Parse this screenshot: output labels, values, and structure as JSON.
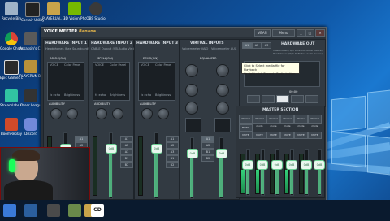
{
  "desktop_icons": [
    {
      "label": "Recycle Bin",
      "icon": "recycle-bin-icon",
      "color": "#9fb3c8"
    },
    {
      "label": "Corsair Utility Engine",
      "icon": "corsair-icon",
      "color": "#222222"
    },
    {
      "label": "PLAYERUN... BATTLEGR...",
      "icon": "pubg-icon",
      "color": "#c9a44a"
    },
    {
      "label": "3D Vision Photo Viewer",
      "icon": "nvidia-3d-icon",
      "color": "#76b900"
    },
    {
      "label": "OBS Studio",
      "icon": "obs-icon",
      "color": "#3a3a3a"
    },
    {
      "label": "Google Chrome",
      "icon": "chrome-icon",
      "color": "#e8c33a"
    },
    {
      "label": "Assassin's Creed Origins",
      "icon": "assassins-creed-icon",
      "color": "#5a5a5a"
    },
    {
      "label": "Epic Games Launcher",
      "icon": "epic-games-icon",
      "color": "#2a2a2a"
    },
    {
      "label": "PLAYERUN BATTLEGR...",
      "icon": "pubg-2-icon",
      "color": "#b8913a"
    },
    {
      "label": "Streamlabs OBS",
      "icon": "streamlabs-icon",
      "color": "#31c3a2"
    },
    {
      "label": "Laser Leagu",
      "icon": "laser-league-icon",
      "color": "#333333"
    },
    {
      "label": "BoomReplay",
      "icon": "boom-replay-icon",
      "color": "#d04a2a"
    },
    {
      "label": "Discord",
      "icon": "discord-icon",
      "color": "#7289da"
    }
  ],
  "vm": {
    "logo_prefix": "VOICE",
    "logo_middle": "MEETER",
    "logo_brand": "Banana",
    "hw_inputs": [
      {
        "title": "HARDWARE INPUT 1",
        "device": "Headphones (Rea Soundcard)",
        "label": "MIMIC(ON)"
      },
      {
        "title": "HARDWARE INPUT 2",
        "device": "CABLE Output (VB-Audio Virt)",
        "label": "SPELL(ON)"
      },
      {
        "title": "HARDWARE INPUT 3",
        "device": "",
        "label": "ECHO(ON)"
      }
    ],
    "intellipan": "Intellipan",
    "voice_label": "VOICE",
    "color_panel": "Color Panel",
    "fx_echo": "fx echo",
    "brightness": "Brightness",
    "audibility": "AUDIBILITY",
    "gate": "Gate",
    "virtual_inputs": "VIRTUAL INPUTS",
    "vi_names": [
      "Voicemeeter VAIO",
      "Voicemeeter AUX"
    ],
    "equalizer": "EQUALIZER",
    "hw_out": "HARDWARE OUT",
    "hw_out_devices": [
      "Headphones (High Definition Audio Device)",
      "Headphones (High Definition Audio Device)"
    ],
    "out_a_labels": [
      "A1",
      "A2",
      "A3"
    ],
    "vban": "VBAN",
    "menu": "Menu",
    "tooltip_line1": "Click to Select media file for Playback",
    "tooltip_line2": "Or right-click Record / Radio button",
    "rec_time": "00:00",
    "master_section": "MASTER SECTION",
    "master_labels": [
      "Normal mode",
      "Normal mode",
      "Normal mode",
      "Normal mode",
      "Normal mode",
      "Normal mode"
    ],
    "bus_labels": [
      "A1",
      "A2",
      "A3",
      "B1",
      "B2"
    ],
    "fader_db": [
      "0dB",
      "0dB",
      "0dB",
      "0dB",
      "0dB",
      "0dB",
      "0dB",
      "0dB",
      "0dB",
      "0dB",
      "0dB"
    ],
    "fader_gain": "Fader Gain",
    "mono": "MONO",
    "solo": "SOLO",
    "mute": "MUTE",
    "win_buttons": [
      "_",
      "□",
      "✕"
    ]
  },
  "taskbar": {
    "icons": [
      "start-icon",
      "streamlabs-task-icon",
      "app-task-icon",
      "settings-task-icon",
      "pubg-task-icon",
      "cd-task-icon"
    ],
    "cd_label": "CD"
  }
}
